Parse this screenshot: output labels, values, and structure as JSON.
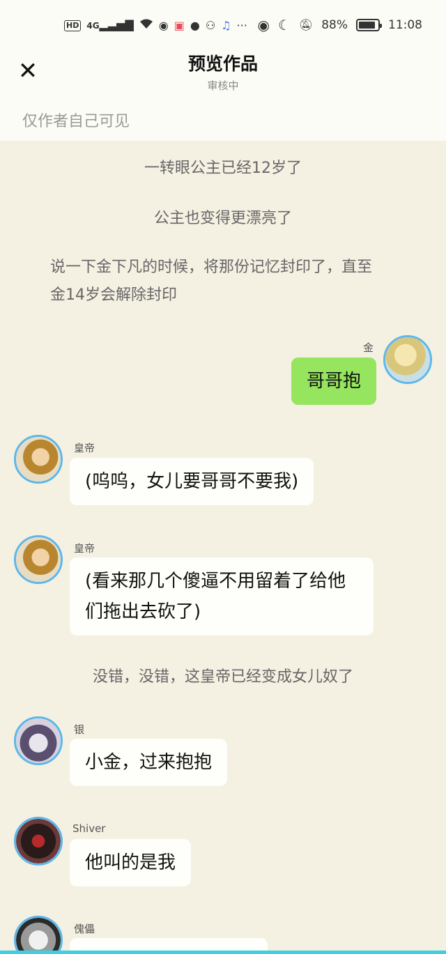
{
  "statusbar": {
    "left_icons": [
      "hd-icon",
      "signal-icon",
      "wifi-icon",
      "app-icon",
      "notes-icon",
      "message-icon",
      "wechat-icon",
      "music-icon",
      "more-icon"
    ],
    "hd": "HD",
    "network": "4G",
    "more": "···",
    "battery_pct": "88%",
    "battery_level": 0.88,
    "time": "11:08"
  },
  "header": {
    "title": "预览作品",
    "subtitle": "审核中",
    "visibility": "仅作者自己可见"
  },
  "narrations": [
    "一转眼公主已经12岁了",
    "公主也变得更漂亮了",
    "说一下金下凡的时候，将那份记忆封印了，直至金14岁会解除封印",
    "没错，没错，这皇帝已经变成女儿奴了"
  ],
  "messages": [
    {
      "name": "金",
      "text": "哥哥抱",
      "side": "right"
    },
    {
      "name": "皇帝",
      "text": "(呜呜，女儿要哥哥不要我)",
      "side": "left"
    },
    {
      "name": "皇帝",
      "text": "(看来那几个傻逼不用留着了给他们拖出去砍了)",
      "side": "left"
    },
    {
      "name": "银",
      "text": "小金，过来抱抱",
      "side": "left"
    },
    {
      "name": "Shiver",
      "text": "他叫的是我",
      "side": "left"
    },
    {
      "name": "傀儡",
      "text": "",
      "side": "left"
    }
  ],
  "colors": {
    "background": "#f4f0e2",
    "header": "#fcfcf6",
    "bubble": "#fefefa",
    "self_bubble": "#95e55f",
    "avatar_ring": "#5cb7ea"
  }
}
